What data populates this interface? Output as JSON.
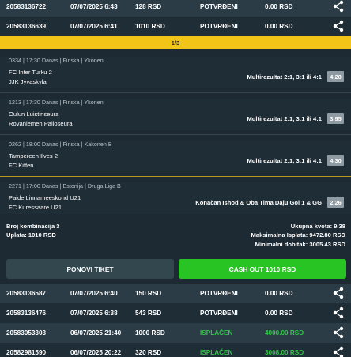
{
  "tickets_top": [
    {
      "id": "20583136722",
      "date": "07/07/2025 6:43",
      "amount": "128 RSD",
      "status": "POTVRĐENI",
      "win": "0.00 RSD"
    },
    {
      "id": "20583136639",
      "date": "07/07/2025 6:41",
      "amount": "1010 RSD",
      "status": "POTVRĐENI",
      "win": "0.00 RSD"
    }
  ],
  "pager": {
    "label": "1/3"
  },
  "matches": [
    {
      "meta": "0334 | 17:30 Danas | Finska | Ykonen",
      "home": "FC Inter Turku 2",
      "away": "JJK Jyvaskyla",
      "pick": "Multirezultat 2:1, 3:1 ili 4:1",
      "odd": "4.20"
    },
    {
      "meta": "1213 | 17:30 Danas | Finska | Ykonen",
      "home": "Oulun Luistinseura",
      "away": "Rovaniemen Palloseura",
      "pick": "Multirezultat 2:1, 3:1 ili 4:1",
      "odd": "3.95"
    },
    {
      "meta": "0262 | 18:00 Danas | Finska | Kakonen B",
      "home": "Tampereen Ilves 2",
      "away": "FC Kiffen",
      "pick": "Multirezultat 2:1, 3:1 ili 4:1",
      "odd": "4.30"
    },
    {
      "meta": "2271 | 17:00 Danas | Estonija | Druga Liga B",
      "home": "Paide Linnameeskond U21",
      "away": "FC Kuressaare U21",
      "pick": "Konačan Ishod & Oba Tima Daju Gol 1 & GG",
      "odd": "2.26"
    }
  ],
  "summary": {
    "combinations": "Broj kombinacija 3",
    "stake": "Uplata: 1010 RSD",
    "total_odds": "Ukupna kvota: 9.38",
    "max_payout": "Maksimalna Isplata: 9472.80 RSD",
    "min_win": "Minimalni dobitak: 3005.43 RSD"
  },
  "buttons": {
    "repeat": "PONOVI TIKET",
    "cashout": "CASH OUT 1010 RSD"
  },
  "tickets_bottom": [
    {
      "id": "20583136587",
      "date": "07/07/2025 6:40",
      "amount": "150 RSD",
      "status": "POTVRĐENI",
      "win": "0.00 RSD"
    },
    {
      "id": "20583136476",
      "date": "07/07/2025 6:38",
      "amount": "543 RSD",
      "status": "POTVRĐENI",
      "win": "0.00 RSD"
    },
    {
      "id": "20583053303",
      "date": "06/07/2025 21:40",
      "amount": "1000 RSD",
      "status": "ISPLAĆEN",
      "win": "4000.00 RSD"
    },
    {
      "id": "20582981590",
      "date": "06/07/2025 20:22",
      "amount": "320 RSD",
      "status": "ISPLAĆEN",
      "win": "3008.00 RSD"
    }
  ],
  "colors": {
    "accent_yellow": "#f2c417",
    "cashout_green": "#27c423",
    "paid_green": "#35c44a"
  },
  "icons": {
    "share": "share-icon",
    "stats": "stats-icon"
  }
}
